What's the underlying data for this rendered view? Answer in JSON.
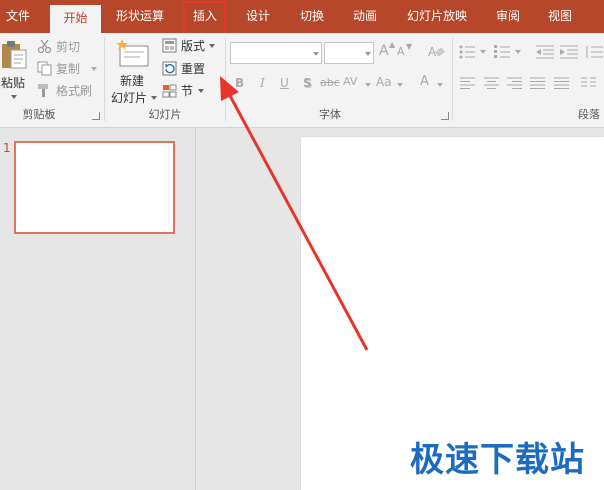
{
  "tabs": [
    {
      "label": "文件"
    },
    {
      "label": "开始"
    },
    {
      "label": "形状运算"
    },
    {
      "label": "插入"
    },
    {
      "label": "设计"
    },
    {
      "label": "切换"
    },
    {
      "label": "动画"
    },
    {
      "label": "幻灯片放映"
    },
    {
      "label": "审阅"
    },
    {
      "label": "视图"
    }
  ],
  "clipboard": {
    "paste": "粘贴",
    "cut": "剪切",
    "copy": "复制",
    "format_painter": "格式刷",
    "group_label": "剪贴板"
  },
  "slides": {
    "new_slide_line1": "新建",
    "new_slide_line2": "幻灯片",
    "layout": "版式",
    "reset": "重置",
    "section": "节",
    "group_label": "幻灯片"
  },
  "font": {
    "family_value": "",
    "size_value": "",
    "bold": "B",
    "italic": "I",
    "underline": "U",
    "shadow": "S",
    "strikethrough": "abc",
    "spacing": "AV",
    "case": "Aa",
    "color": "A",
    "group_label": "字体"
  },
  "paragraph": {
    "group_label": "段落"
  },
  "slide_pane": {
    "slide_number": "1"
  },
  "watermark": "极速下载站",
  "colors": {
    "ribbon_red": "#b7472a",
    "highlight": "#e8352b",
    "thumb_border": "#e0745a",
    "watermark": "#1c6bc2"
  }
}
